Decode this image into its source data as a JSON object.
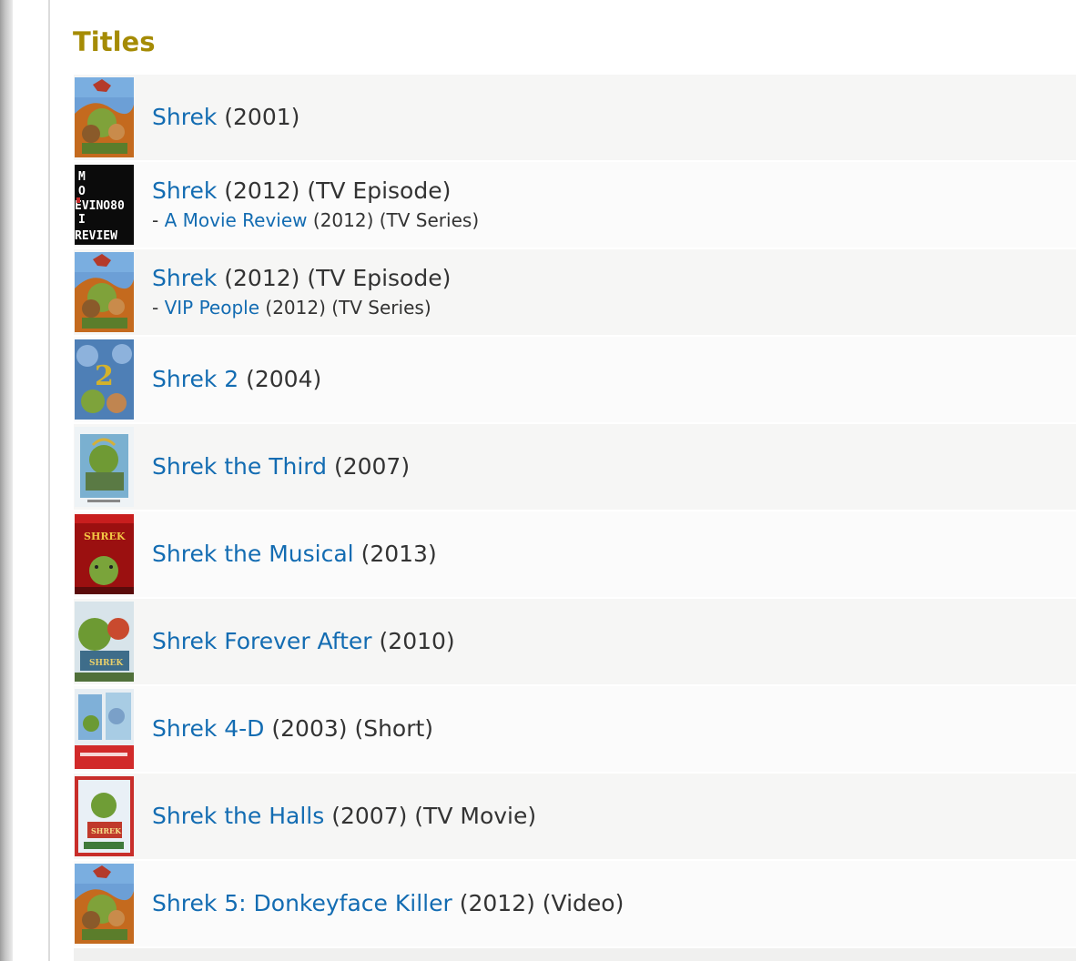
{
  "section": {
    "title": "Titles"
  },
  "results": [
    {
      "title": "Shrek",
      "detail": "(2001)",
      "sub": null,
      "poster": "shrek"
    },
    {
      "title": "Shrek",
      "detail": "(2012) (TV Episode)",
      "sub": {
        "prefix": "-",
        "title": "A Movie Review",
        "detail": "(2012) (TV Series)"
      },
      "poster": "review"
    },
    {
      "title": "Shrek",
      "detail": "(2012) (TV Episode)",
      "sub": {
        "prefix": "-",
        "title": "VIP People",
        "detail": "(2012) (TV Series)"
      },
      "poster": "shrek"
    },
    {
      "title": "Shrek 2",
      "detail": "(2004)",
      "sub": null,
      "poster": "shrek2"
    },
    {
      "title": "Shrek the Third",
      "detail": "(2007)",
      "sub": null,
      "poster": "third"
    },
    {
      "title": "Shrek the Musical",
      "detail": "(2013)",
      "sub": null,
      "poster": "musical"
    },
    {
      "title": "Shrek Forever After",
      "detail": "(2010)",
      "sub": null,
      "poster": "forever"
    },
    {
      "title": "Shrek 4-D",
      "detail": "(2003) (Short)",
      "sub": null,
      "poster": "fourd"
    },
    {
      "title": "Shrek the Halls",
      "detail": "(2007) (TV Movie)",
      "sub": null,
      "poster": "halls"
    },
    {
      "title": "Shrek 5: Donkeyface Killer",
      "detail": "(2012) (Video)",
      "sub": null,
      "poster": "shrek"
    }
  ],
  "colors": {
    "title": "#a58b05",
    "link": "#136cb2",
    "text": "#333333"
  },
  "poster_text": {
    "review": [
      "M",
      "O",
      "EVINO80",
      "I",
      "REVIEW"
    ]
  }
}
